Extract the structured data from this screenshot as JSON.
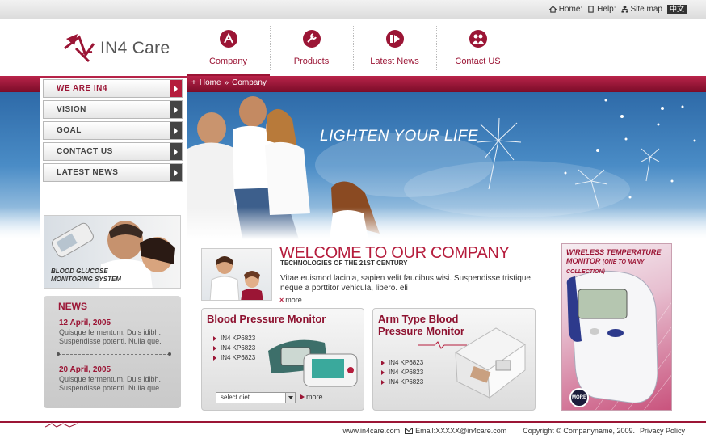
{
  "utility": {
    "home": "Home:",
    "help": "Help:",
    "sitemap": "Site map",
    "lang": "中文"
  },
  "brand": {
    "name": "IN4 Care"
  },
  "nav": [
    {
      "label": "Company",
      "icon": "gear-icon"
    },
    {
      "label": "Products",
      "icon": "wrench-icon"
    },
    {
      "label": "Latest News",
      "icon": "play-icon"
    },
    {
      "label": "Contact US",
      "icon": "people-icon"
    }
  ],
  "breadcrumb": {
    "home": "Home",
    "sep": "»",
    "current": "Company"
  },
  "hero": {
    "tagline": "LIGHTEN YOUR LIFE"
  },
  "sidemenu": [
    "WE ARE IN4",
    "VISION",
    "GOAL",
    "CONTACT US",
    "LATEST NEWS"
  ],
  "promo": {
    "line1": "BLOOD GLUCOSE",
    "line2": "MONITORING SYSTEM"
  },
  "news": {
    "title": "NEWS",
    "items": [
      {
        "date": "12 April, 2005",
        "line1": "Quisque fermentum. Duis idibh.",
        "line2": "Suspendisse potenti. Nulla que."
      },
      {
        "date": "20 April, 2005",
        "line1": "Quisque fermentum. Duis idibh.",
        "line2": "Suspendisse potenti. Nulla que."
      }
    ]
  },
  "welcome": {
    "title": "WELCOME TO OUR COMPANY",
    "subtitle": "TECHNOLOGIES OF THE 21ST CENTURY",
    "text": "Vitae euismod lacinia, sapien velit faucibus wisi. Suspendisse tristique, neque a porttitor vehicula, libero. eli",
    "more": "more"
  },
  "products": [
    {
      "title": "Blood Pressure Monitor",
      "items": [
        "IN4 KP6823",
        "IN4 KP6823",
        "IN4 KP6823"
      ],
      "select": "select diet",
      "more": "more"
    },
    {
      "title_line1": "Arm Type Blood",
      "title_line2": "Pressure Monitor",
      "items": [
        "IN4 KP6823",
        "IN4 KP6823",
        "IN4 KP6823"
      ]
    }
  ],
  "ad": {
    "line1": "WIRELESS TEMPERATURE",
    "line2": "MONITOR",
    "line3": "(ONE TO MANY COLLECTION)",
    "more": "MORE"
  },
  "footer": {
    "site": "www.in4care.com",
    "email": "Email:XXXXX@in4care.com",
    "copyright": "Copyright © Companyname, 2009.",
    "privacy": "Privacy Policy"
  },
  "colors": {
    "brand": "#9b1535",
    "accent": "#b51c3c",
    "sky": "#4a8cc6"
  }
}
